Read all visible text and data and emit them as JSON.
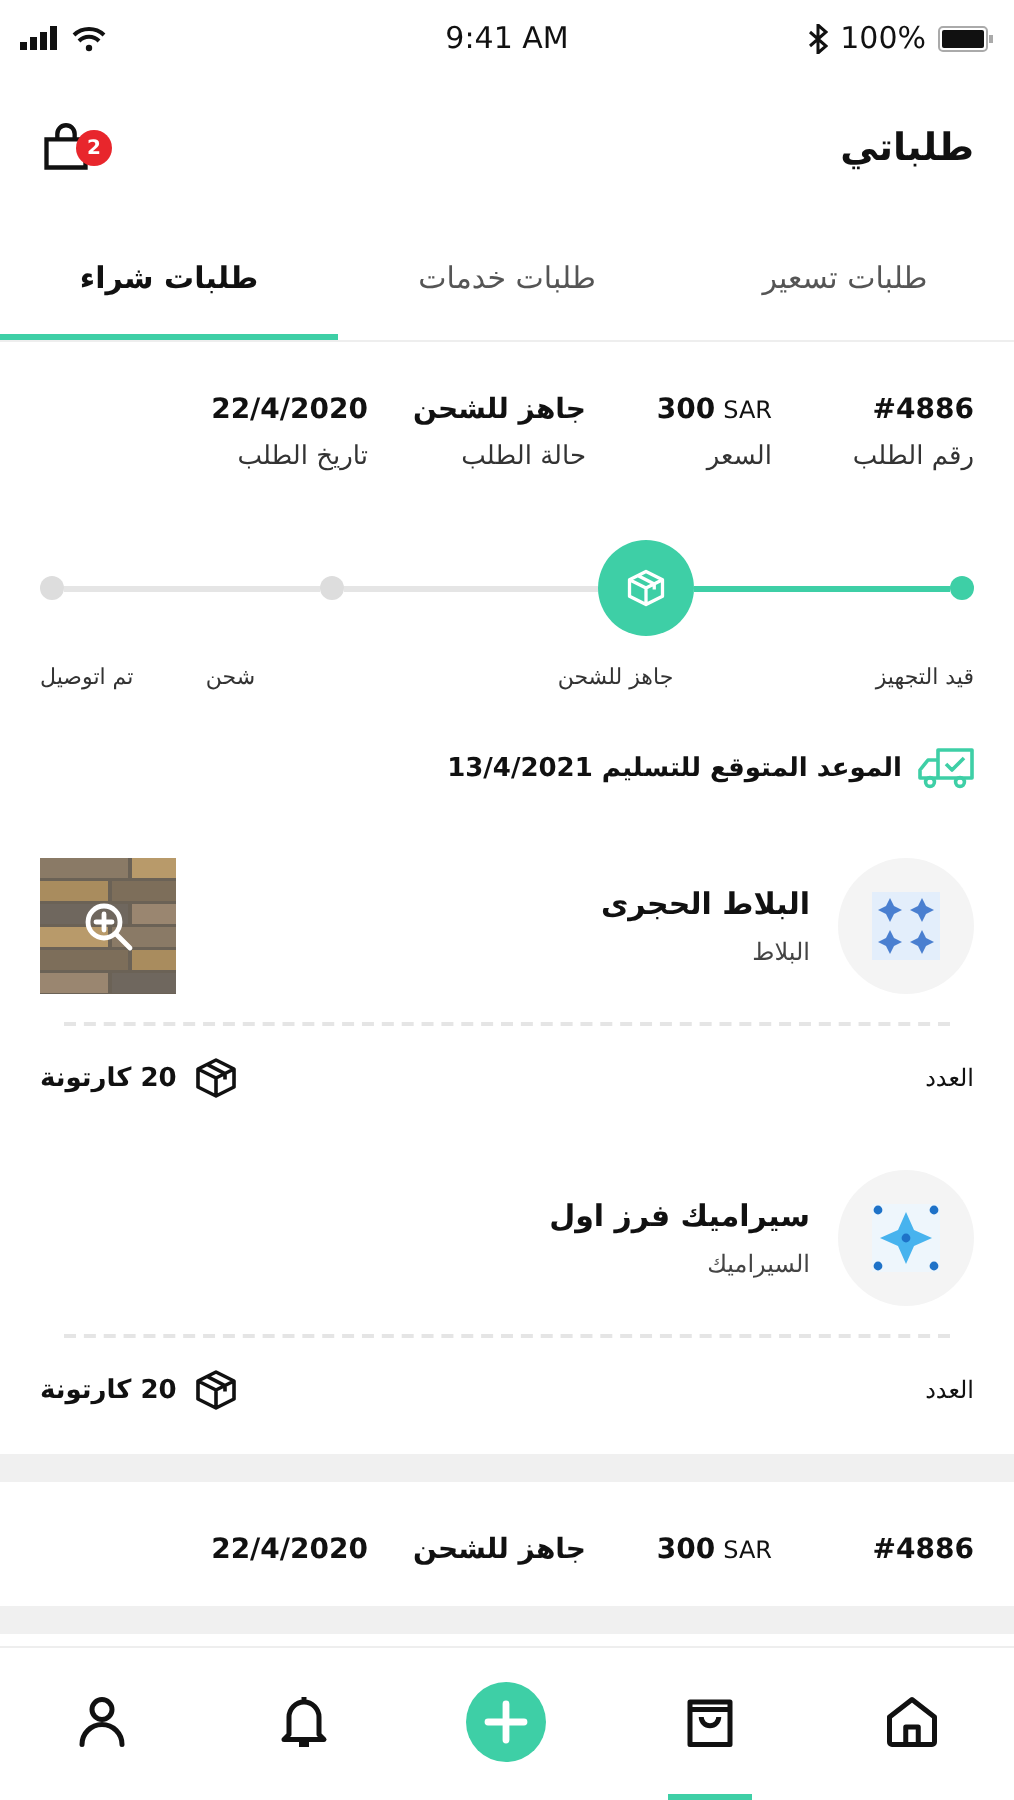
{
  "status_bar": {
    "time": "9:41 AM",
    "battery": "100%"
  },
  "header": {
    "title": "طلباتي",
    "cart_badge": "2"
  },
  "tabs": [
    {
      "label": "طلبات تسعير",
      "selected": false
    },
    {
      "label": "طلبات خدمات",
      "selected": false
    },
    {
      "label": "طلبات شراء",
      "selected": true
    }
  ],
  "orders": [
    {
      "fields": [
        {
          "value": "#4886",
          "label": "رقم الطلب"
        },
        {
          "value": "300",
          "unit": "SAR",
          "label": "السعر"
        },
        {
          "value": "جاهز للشحن",
          "label": "حالة الطلب"
        },
        {
          "value": "22/4/2020",
          "label": "تاريخ الطلب"
        }
      ],
      "steps": [
        {
          "label": "قيد التجهيز",
          "kind": "done"
        },
        {
          "label": "جاهز للشحن",
          "kind": "current"
        },
        {
          "label": "شحن",
          "kind": "pending"
        },
        {
          "label": "تم اتوصيل",
          "kind": "pending"
        }
      ],
      "delivery": {
        "label": "الموعد المتوقع للتسليم",
        "date": "13/4/2021"
      },
      "items": [
        {
          "name": "البلاط الحجرى",
          "category": "البلاط",
          "count_label": "العدد",
          "count": "20",
          "unit": "كارتونة",
          "kind": "dots"
        },
        {
          "name": "سيراميك فرز اول",
          "category": "السيراميك",
          "count_label": "العدد",
          "count": "20",
          "unit": "كارتونة",
          "kind": "star"
        }
      ]
    },
    {
      "fields": [
        {
          "value": "#4886"
        },
        {
          "value": "300",
          "unit": "SAR"
        },
        {
          "value": "جاهز للشحن"
        },
        {
          "value": "22/4/2020"
        }
      ]
    }
  ],
  "bottom_nav": [
    {
      "kind": "home",
      "selected": false
    },
    {
      "kind": "bag",
      "selected": true
    },
    {
      "kind": "add",
      "selected": false
    },
    {
      "kind": "bell",
      "selected": false
    },
    {
      "kind": "person",
      "selected": false
    }
  ]
}
